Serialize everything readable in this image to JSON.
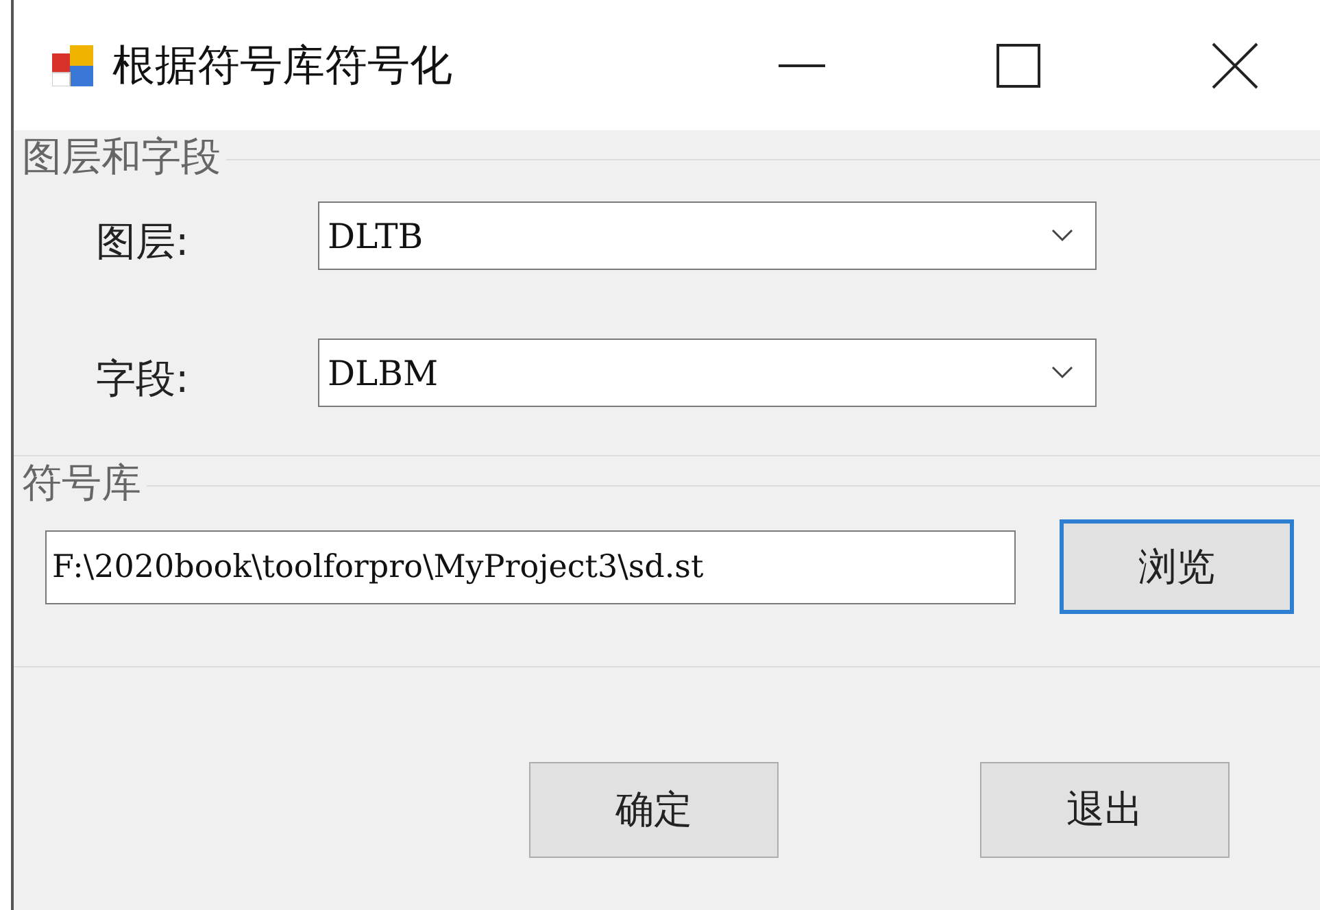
{
  "window": {
    "title": "根据符号库符号化"
  },
  "layer_group": {
    "title": "图层和字段",
    "fields": [
      {
        "label": "图层:",
        "value": "DLTB"
      },
      {
        "label": "字段:",
        "value": "DLBM"
      }
    ]
  },
  "symbol_group": {
    "title": "符号库",
    "path": "F:\\2020book\\toolforpro\\MyProject3\\sd.st",
    "browse": {
      "label": "浏览",
      "focused": true
    }
  },
  "buttons": [
    {
      "label": "确定",
      "focused": false
    },
    {
      "label": "退出",
      "focused": false
    }
  ]
}
